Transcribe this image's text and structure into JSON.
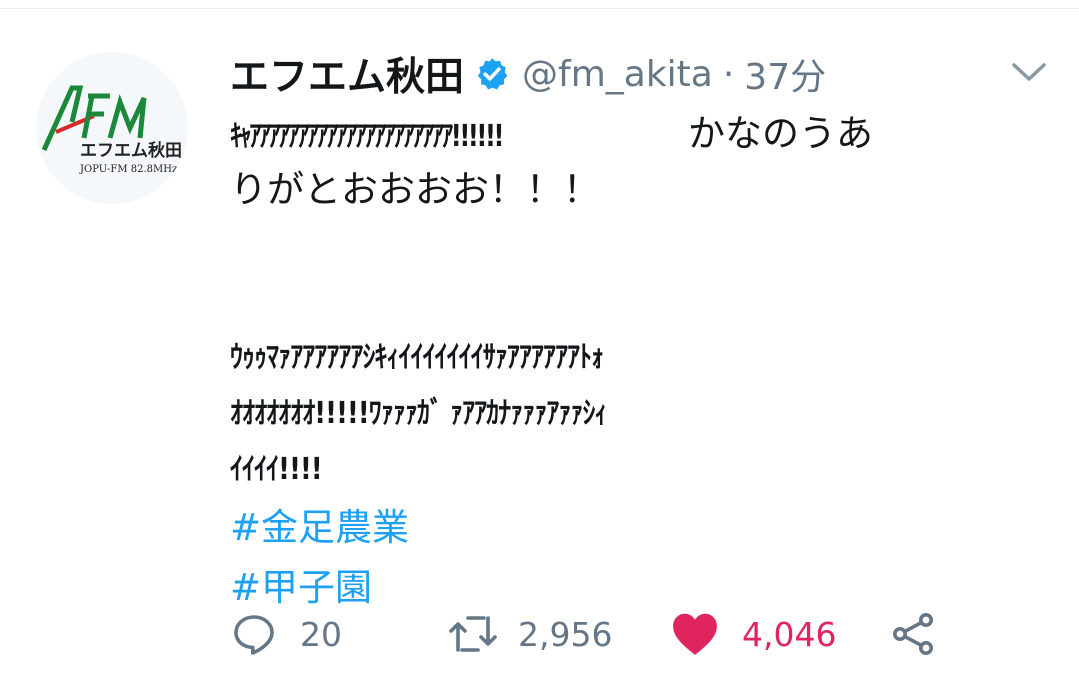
{
  "tweet": {
    "display_name": "エフエム秋田",
    "handle": "@fm_akita",
    "separator": "·",
    "time": "37分",
    "verified_icon": "verified-badge-icon",
    "menu_icon": "chevron-down-icon",
    "avatar": {
      "logo_letters": "AFM",
      "logo_name": "エフエム秋田",
      "logo_sub": "JOPU-FM 82.8MHz"
    },
    "lines": {
      "l1": "ｷｬｱｱｱｱｱｱｱｱｱｱｱｱｱｱｱｱｱｱｱｱｱ!!!!!!",
      "l1_tail": "かなのうあ",
      "l2": "りがとおおおお！！！",
      "l3": "ｳｩｩﾏｧｱｱｱｱｱｱｼｷｨｲｲｲｲｲｲｲｻｧｱｱｱｱｱｱﾄｫ",
      "l4": "ｵｵｵｵｵｵｵ!!!!!ﾜｧｧｧｶﾞ ｧｱｱｶﾅｧｧｧｱｧｧｼｨ",
      "l5": "ｲｲｲｲ!!!!"
    },
    "hashtags": [
      "#金足農業",
      "#甲子園"
    ],
    "actions": {
      "reply_count": "20",
      "retweet_count": "2,956",
      "like_count": "4,046"
    },
    "colors": {
      "link": "#1da1f2",
      "like": "#e0245e",
      "muted": "#657786",
      "logo_green": "#1a8a3a",
      "logo_red": "#d42a2a"
    }
  }
}
